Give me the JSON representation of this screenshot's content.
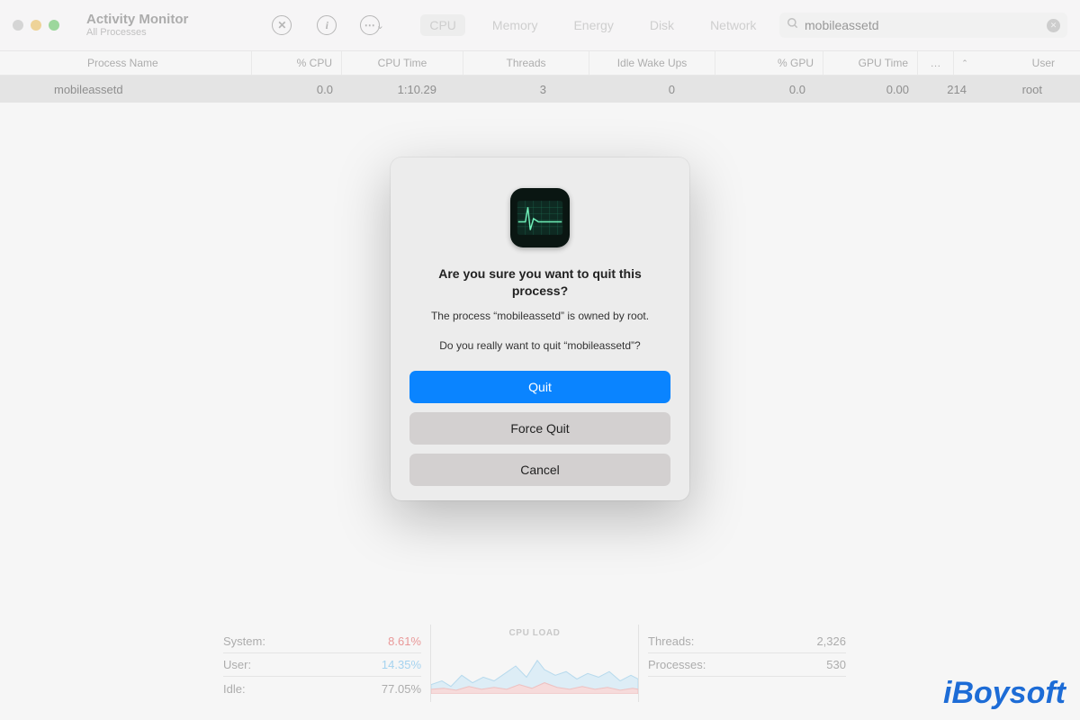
{
  "header": {
    "app_title": "Activity Monitor",
    "app_subtitle": "All Processes",
    "tabs": [
      "CPU",
      "Memory",
      "Energy",
      "Disk",
      "Network"
    ],
    "active_tab": "CPU",
    "search_value": "mobileassetd"
  },
  "table": {
    "columns": {
      "name": "Process Name",
      "cpu": "% CPU",
      "cputime": "CPU Time",
      "threads": "Threads",
      "wake": "Idle Wake Ups",
      "gpu": "% GPU",
      "gputime": "GPU Time",
      "more": "…",
      "user": "User"
    },
    "rows": [
      {
        "name": "mobileassetd",
        "cpu": "0.0",
        "cputime": "1:10.29",
        "threads": "3",
        "wake": "0",
        "gpu": "0.0",
        "gputime": "0.00",
        "more": "214",
        "user": "root"
      }
    ]
  },
  "footer": {
    "cpu_load_title": "CPU LOAD",
    "left": {
      "system_label": "System:",
      "system_value": "8.61%",
      "system_color": "#dc5a5a",
      "user_label": "User:",
      "user_value": "14.35%",
      "user_color": "#6fb8e6",
      "idle_label": "Idle:",
      "idle_value": "77.05%"
    },
    "right": {
      "threads_label": "Threads:",
      "threads_value": "2,326",
      "processes_label": "Processes:",
      "processes_value": "530"
    }
  },
  "dialog": {
    "title": "Are you sure you want to quit this process?",
    "message1": "The process “mobileassetd” is owned by root.",
    "message2": "Do you really want to quit “mobileassetd”?",
    "btn_quit": "Quit",
    "btn_force": "Force Quit",
    "btn_cancel": "Cancel"
  },
  "watermark": "iBoysoft"
}
